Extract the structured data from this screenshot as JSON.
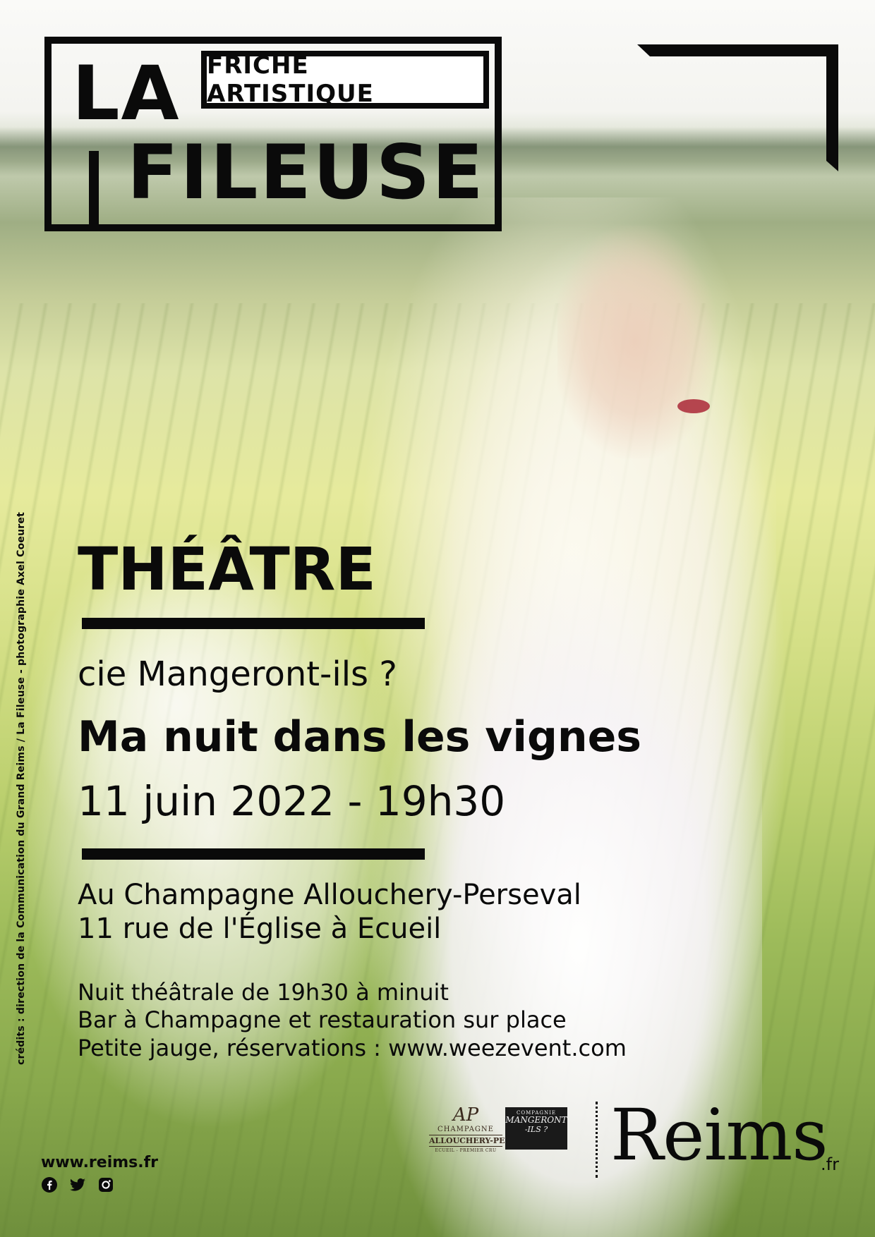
{
  "logo": {
    "tag": "FRICHE ARTISTIQUE",
    "la": "LA",
    "fileuse": "FILEUSE"
  },
  "event": {
    "genre": "THÉÂTRE",
    "company": "cie Mangeront-ils ?",
    "title": "Ma nuit dans les vignes",
    "date": "11 juin 2022 - 19h30"
  },
  "venue": {
    "line1": "Au Champagne Allouchery-Perseval",
    "line2": "11 rue de l'Église à Ecueil"
  },
  "details": [
    "Nuit théâtrale de 19h30 à minuit",
    "Bar à Champagne et restauration sur place",
    "Petite jauge, réservations : www.weezevent.com"
  ],
  "credits": "crédits : direction de la Communication du Grand Reims / La Fileuse - photographie Axel Coeuret",
  "footer": {
    "website": "www.reims.fr",
    "social_icons": [
      "facebook-icon",
      "twitter-icon",
      "instagram-icon"
    ]
  },
  "partners": {
    "champagne": {
      "monogram": "AP",
      "label": "CHAMPAGNE",
      "name": "ALLOUCHERY-PERSEVAL",
      "sub": "ECUEIL - PREMIER CRU"
    },
    "company": {
      "line1": "COMPAGNIE",
      "line2": "MANGERONT",
      "line3": "-ILS ?"
    },
    "city": {
      "name": "Reims",
      "tld": ".fr"
    }
  },
  "colors": {
    "ink": "#0a0a0a",
    "paper": "#ffffff"
  }
}
